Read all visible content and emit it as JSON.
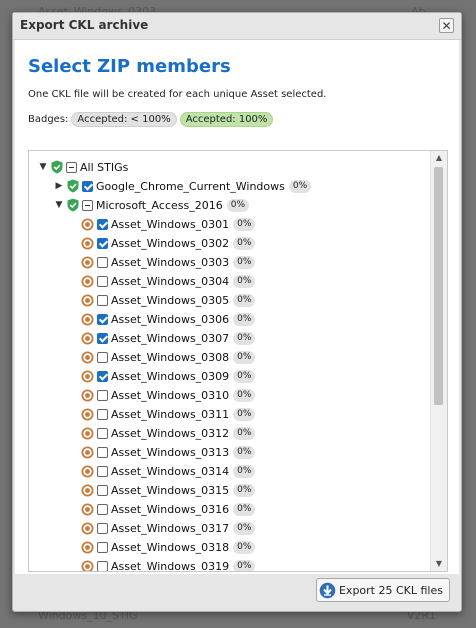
{
  "background": {
    "top_row_text": "Asset_Windows_0303",
    "top_row_right": "Ab...",
    "bottom_row_text": "Windows_10_STIG",
    "bottom_row_right": "V2R1"
  },
  "dialog": {
    "title": "Export CKL archive",
    "close_glyph": "✕",
    "heading": "Select ZIP members",
    "description": "One CKL file will be created for each unique Asset selected.",
    "badges_label": "Badges:",
    "badge_review": "Accepted: < 100%",
    "badge_accepted": "Accepted: 100%",
    "export_button": "Export 25 CKL files"
  },
  "tree": {
    "root": {
      "label": "All STIGs",
      "state": "partial"
    },
    "stigs": [
      {
        "label": "Google_Chrome_Current_Windows",
        "pct": "0%",
        "state": "checked",
        "expanded": false
      },
      {
        "label": "Microsoft_Access_2016",
        "pct": "0%",
        "state": "partial",
        "expanded": true
      }
    ],
    "assets": [
      {
        "label": "Asset_Windows_0301",
        "pct": "0%",
        "checked": true
      },
      {
        "label": "Asset_Windows_0302",
        "pct": "0%",
        "checked": true
      },
      {
        "label": "Asset_Windows_0303",
        "pct": "0%",
        "checked": false
      },
      {
        "label": "Asset_Windows_0304",
        "pct": "0%",
        "checked": false
      },
      {
        "label": "Asset_Windows_0305",
        "pct": "0%",
        "checked": false
      },
      {
        "label": "Asset_Windows_0306",
        "pct": "0%",
        "checked": true
      },
      {
        "label": "Asset_Windows_0307",
        "pct": "0%",
        "checked": true
      },
      {
        "label": "Asset_Windows_0308",
        "pct": "0%",
        "checked": false
      },
      {
        "label": "Asset_Windows_0309",
        "pct": "0%",
        "checked": true
      },
      {
        "label": "Asset_Windows_0310",
        "pct": "0%",
        "checked": false
      },
      {
        "label": "Asset_Windows_0311",
        "pct": "0%",
        "checked": false
      },
      {
        "label": "Asset_Windows_0312",
        "pct": "0%",
        "checked": false
      },
      {
        "label": "Asset_Windows_0313",
        "pct": "0%",
        "checked": false
      },
      {
        "label": "Asset_Windows_0314",
        "pct": "0%",
        "checked": false
      },
      {
        "label": "Asset_Windows_0315",
        "pct": "0%",
        "checked": false
      },
      {
        "label": "Asset_Windows_0316",
        "pct": "0%",
        "checked": false
      },
      {
        "label": "Asset_Windows_0317",
        "pct": "0%",
        "checked": false
      },
      {
        "label": "Asset_Windows_0318",
        "pct": "0%",
        "checked": false
      },
      {
        "label": "Asset_Windows_0319",
        "pct": "0%",
        "checked": false
      }
    ]
  },
  "colors": {
    "heading": "#1a6fc4",
    "checkbox_checked": "#1a6fc4",
    "accepted_badge": "#bfe3a8",
    "shield": "#3aa655",
    "target_ring": "#c97a3a"
  },
  "icons": {
    "accepted": "shield-check-icon",
    "review": "target-icon",
    "export": "download-icon"
  }
}
